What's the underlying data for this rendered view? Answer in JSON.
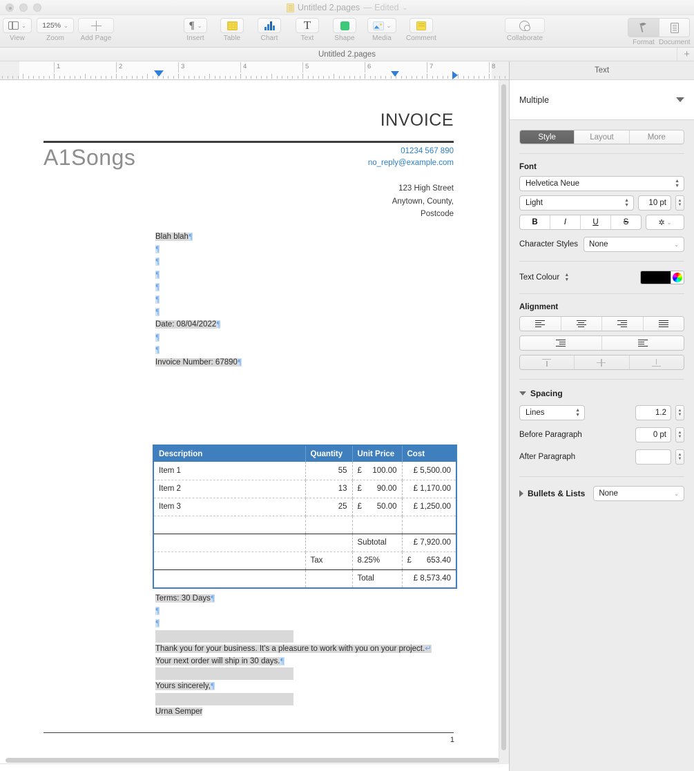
{
  "window": {
    "title": "Untitled 2.pages",
    "edited_suffix": "— Edited",
    "chevron": "⌄"
  },
  "toolbar": {
    "items": [
      {
        "label": "View",
        "icon": "view-icon",
        "has_chevron": true
      },
      {
        "label": "Zoom",
        "icon": "zoom-value",
        "value": "125%",
        "has_chevron": true
      },
      {
        "label": "Add Page",
        "icon": "plus-icon",
        "has_chevron": false
      },
      {
        "label": "Insert",
        "icon": "pilcrow-icon",
        "has_chevron": true
      },
      {
        "label": "Table",
        "icon": "table-icon",
        "has_chevron": false
      },
      {
        "label": "Chart",
        "icon": "chart-icon",
        "has_chevron": false
      },
      {
        "label": "Text",
        "icon": "text-icon",
        "has_chevron": false
      },
      {
        "label": "Shape",
        "icon": "shape-icon",
        "has_chevron": false
      },
      {
        "label": "Media",
        "icon": "media-icon",
        "has_chevron": true
      },
      {
        "label": "Comment",
        "icon": "comment-icon",
        "has_chevron": false
      },
      {
        "label": "Collaborate",
        "icon": "collaborate-icon",
        "has_chevron": false
      }
    ],
    "format_label": "Format",
    "document_label": "Document",
    "zoom_value": "125%"
  },
  "tabbar": {
    "tab_name": "Untitled 2.pages",
    "add_tab": "+"
  },
  "ruler": {
    "numbers": [
      "1",
      "2",
      "3",
      "4",
      "5",
      "6",
      "7",
      "8"
    ]
  },
  "document": {
    "invoice_title": "INVOICE",
    "brand": "A1Songs",
    "phone": "01234 567 890",
    "email": "no_reply@example.com",
    "address": [
      "123 High Street",
      "Anytown, County,",
      "Postcode"
    ],
    "lines": [
      "Blah blah",
      "",
      "",
      "",
      "",
      "",
      "",
      "Date: 08/04/2022",
      "",
      "",
      "Invoice Number: 67890"
    ],
    "closing": {
      "terms": "Terms: 30 Days",
      "thanks_line1": "Thank you for your business. It's a pleasure to work with you on your project.",
      "thanks_line2": "Your next order will ship in 30 days.",
      "signoff": "Yours sincerely,",
      "name": "Urna Semper"
    },
    "page_number": "1"
  },
  "table": {
    "headers": [
      "Description",
      "Quantity",
      "Unit Price",
      "Cost"
    ],
    "rows": [
      {
        "description": "Item 1",
        "quantity": "55",
        "currency": "£",
        "unit_price": "100.00",
        "cost": "£ 5,500.00"
      },
      {
        "description": "Item 2",
        "quantity": "13",
        "currency": "£",
        "unit_price": "90.00",
        "cost": "£ 1,170.00"
      },
      {
        "description": "Item 3",
        "quantity": "25",
        "currency": "£",
        "unit_price": "50.00",
        "cost": "£ 1,250.00"
      },
      {
        "description": "",
        "quantity": "",
        "currency": "",
        "unit_price": "",
        "cost": ""
      }
    ],
    "summary": [
      {
        "label_col": "",
        "label": "Subtotal",
        "value": "£ 7,920.00"
      },
      {
        "label_col": "Tax",
        "label": "8.25%",
        "value": "£    653.40"
      },
      {
        "label_col": "",
        "label": "Total",
        "value": "£ 8,573.40"
      }
    ],
    "header_color": "#3f7fbe"
  },
  "inspector": {
    "title": "Text",
    "paragraph_style": "Multiple",
    "tabs": [
      "Style",
      "Layout",
      "More"
    ],
    "selected_tab": "Style",
    "font_section_label": "Font",
    "font_family": "Helvetica Neue",
    "font_weight": "Light",
    "font_size": "10 pt",
    "style_buttons": [
      "B",
      "I",
      "U",
      "S"
    ],
    "gear_label": "⚙",
    "character_styles_label": "Character Styles",
    "character_styles_value": "None",
    "text_colour_label": "Text Colour",
    "text_colour_value": "#000000",
    "alignment_label": "Alignment",
    "spacing_label": "Spacing",
    "spacing_mode": "Lines",
    "spacing_value": "1.2",
    "before_paragraph_label": "Before Paragraph",
    "before_paragraph_value": "0 pt",
    "after_paragraph_label": "After Paragraph",
    "after_paragraph_value": "",
    "bullets_label": "Bullets & Lists",
    "bullets_value": "None"
  }
}
